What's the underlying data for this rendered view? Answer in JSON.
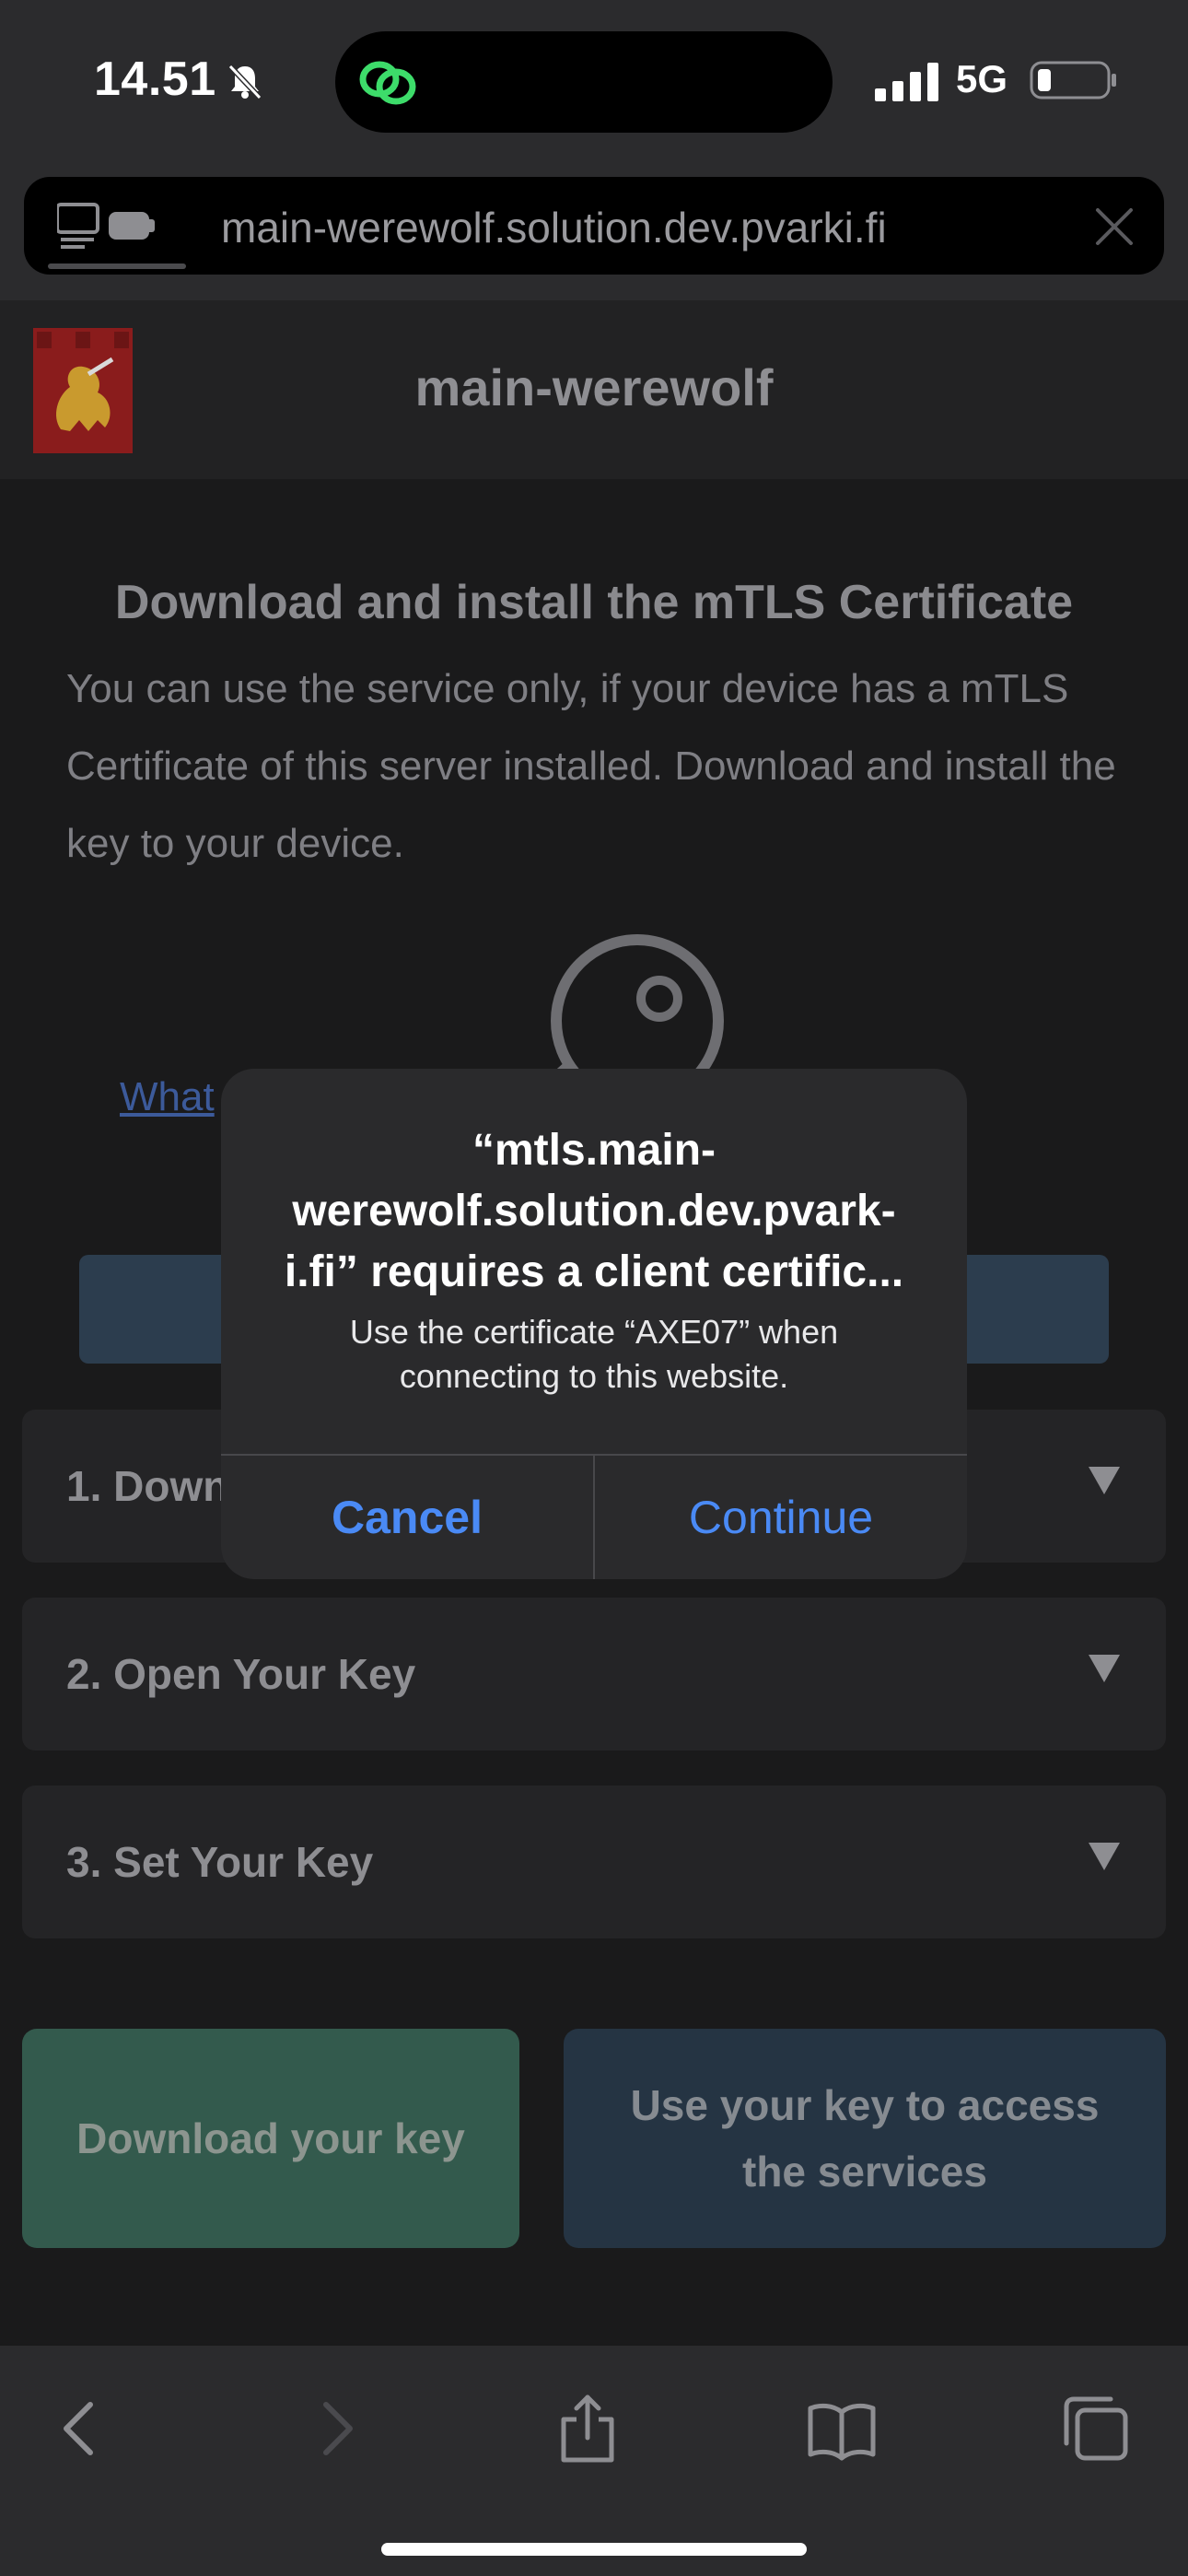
{
  "status_bar": {
    "time": "14.51",
    "network": "5G",
    "icons": [
      "bell-slash-icon",
      "link-icon",
      "signal-icon",
      "battery-icon"
    ]
  },
  "url_bar": {
    "url": "main-werewolf.solution.dev.pvarki.fi",
    "icons": [
      "tab-sidebar-icon",
      "close-icon"
    ]
  },
  "site": {
    "title": "main-werewolf",
    "logo": "lion-crest-logo"
  },
  "content": {
    "heading": "Download and install the mTLS Certificate",
    "intro": "You can use the service only, if your device has a mTLS Certificate of this server installed. Download and install the key to your device.",
    "link_text": "What"
  },
  "accordion": [
    {
      "label": "1. Down"
    },
    {
      "label": "2. Open Your Key"
    },
    {
      "label": "3. Set Your Key"
    }
  ],
  "buttons": {
    "download": "Download your key",
    "use": "Use your key to access the services"
  },
  "dialog": {
    "title": "“mtls.main-werewolf.solution.dev.pvark-i.fi” requires a client certific...",
    "title_lines": [
      "“mtls.main-",
      "werewolf.solution.dev.pvark-",
      "i.fi” requires a client certific..."
    ],
    "message": "Use the certificate “AXE07” when connecting to this website.",
    "cancel": "Cancel",
    "continue": "Continue"
  },
  "toolbar": {
    "icons": [
      "back-icon",
      "forward-icon",
      "share-icon",
      "bookmarks-icon",
      "tabs-icon"
    ]
  },
  "colors": {
    "accent_blue": "#4a8af5",
    "download_green": "#335a4d",
    "use_blue": "#253443",
    "link_green": "#3ddc6a"
  }
}
